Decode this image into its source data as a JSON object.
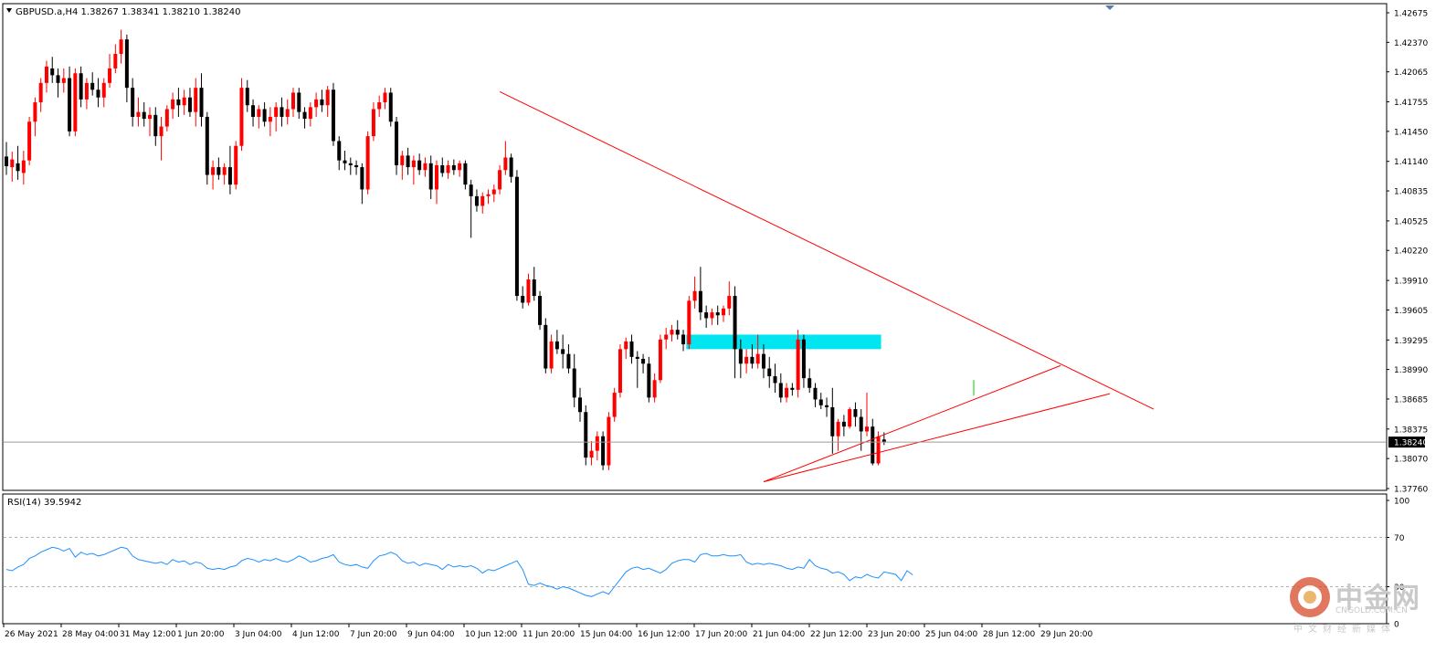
{
  "chart_data": [
    {
      "type": "candlestick",
      "symbol_header": "GBPUSD.a,H4  1.38267 1.38341 1.38210 1.38240",
      "ylim": [
        1.3776,
        1.42675
      ],
      "y_ticks": [
        "1.42675",
        "1.42370",
        "1.42065",
        "1.41755",
        "1.41450",
        "1.41140",
        "1.40835",
        "1.40525",
        "1.40220",
        "1.39910",
        "1.39605",
        "1.39295",
        "1.38990",
        "1.38685",
        "1.38375",
        "1.38070",
        "1.37760"
      ],
      "current_price": "1.38240",
      "x_tick_labels": [
        "26 May 2021",
        "28 May 04:00",
        "31 May 12:00",
        "1 Jun 20:00",
        "3 Jun 04:00",
        "4 Jun 12:00",
        "7 Jun 20:00",
        "9 Jun 04:00",
        "10 Jun 12:00",
        "11 Jun 20:00",
        "15 Jun 04:00",
        "16 Jun 12:00",
        "17 Jun 20:00",
        "21 Jun 04:00",
        "22 Jun 12:00",
        "23 Jun 20:00",
        "25 Jun 04:00",
        "28 Jun 12:00",
        "29 Jun 20:00"
      ],
      "colors": {
        "bull": "#ff0000",
        "bear": "#000000",
        "trendline": "#ff0000",
        "zone": "#00e5f0",
        "signal": "#00cc00"
      },
      "zone": {
        "from_bar": 1,
        "to_bar": 34,
        "bars_before_last": true,
        "price_low": 1.392,
        "price_high": 1.3935
      },
      "trendlines": [
        {
          "p1": [
            1.4186,
            "10 Jun 12:00"
          ],
          "p2": [
            1.3858,
            "beyond last bar"
          ]
        },
        {
          "p1": [
            1.3783,
            "18 Jun"
          ],
          "p2": [
            1.3903,
            "25 Jun"
          ]
        },
        {
          "p1": [
            1.3783,
            "18 Jun"
          ],
          "p2": [
            1.3874,
            "29 Jun"
          ]
        }
      ],
      "candles": [
        [
          1.4119,
          1.4134,
          1.41,
          1.4109
        ],
        [
          1.4108,
          1.4124,
          1.4093,
          1.4116
        ],
        [
          1.4112,
          1.413,
          1.4095,
          1.4104
        ],
        [
          1.4102,
          1.4125,
          1.409,
          1.4115
        ],
        [
          1.4115,
          1.416,
          1.411,
          1.4155
        ],
        [
          1.4155,
          1.418,
          1.414,
          1.4175
        ],
        [
          1.4175,
          1.42,
          1.4165,
          1.4195
        ],
        [
          1.4195,
          1.4218,
          1.4185,
          1.4212
        ],
        [
          1.421,
          1.4222,
          1.4195,
          1.4203
        ],
        [
          1.4203,
          1.421,
          1.418,
          1.4195
        ],
        [
          1.4195,
          1.421,
          1.4185,
          1.42
        ],
        [
          1.42,
          1.4212,
          1.414,
          1.4145
        ],
        [
          1.4145,
          1.421,
          1.414,
          1.4205
        ],
        [
          1.4205,
          1.4212,
          1.417,
          1.4178
        ],
        [
          1.4178,
          1.42,
          1.4168,
          1.4195
        ],
        [
          1.4195,
          1.4206,
          1.4182,
          1.4188
        ],
        [
          1.4188,
          1.42,
          1.417,
          1.418
        ],
        [
          1.418,
          1.42,
          1.417,
          1.4195
        ],
        [
          1.4195,
          1.4225,
          1.419,
          1.421
        ],
        [
          1.421,
          1.4235,
          1.4205,
          1.4225
        ],
        [
          1.4225,
          1.425,
          1.4215,
          1.424
        ],
        [
          1.424,
          1.4245,
          1.4175,
          1.419
        ],
        [
          1.419,
          1.42,
          1.415,
          1.416
        ],
        [
          1.416,
          1.418,
          1.415,
          1.4165
        ],
        [
          1.4165,
          1.4175,
          1.415,
          1.4158
        ],
        [
          1.4158,
          1.417,
          1.414,
          1.4162
        ],
        [
          1.4162,
          1.417,
          1.413,
          1.414
        ],
        [
          1.414,
          1.416,
          1.4115,
          1.415
        ],
        [
          1.415,
          1.4172,
          1.4145,
          1.4168
        ],
        [
          1.4168,
          1.4185,
          1.4158,
          1.4178
        ],
        [
          1.4178,
          1.419,
          1.416,
          1.4172
        ],
        [
          1.4172,
          1.4188,
          1.4162,
          1.418
        ],
        [
          1.418,
          1.419,
          1.416,
          1.4165
        ],
        [
          1.4165,
          1.42,
          1.415,
          1.419
        ],
        [
          1.419,
          1.4205,
          1.415,
          1.416
        ],
        [
          1.416,
          1.4165,
          1.409,
          1.41
        ],
        [
          1.41,
          1.4115,
          1.4085,
          1.4108
        ],
        [
          1.4108,
          1.4118,
          1.4095,
          1.41
        ],
        [
          1.41,
          1.4112,
          1.409,
          1.4108
        ],
        [
          1.4108,
          1.413,
          1.408,
          1.409
        ],
        [
          1.409,
          1.4135,
          1.4085,
          1.413
        ],
        [
          1.413,
          1.42,
          1.4125,
          1.419
        ],
        [
          1.419,
          1.4198,
          1.4165,
          1.4172
        ],
        [
          1.4172,
          1.4178,
          1.415,
          1.416
        ],
        [
          1.416,
          1.4172,
          1.4148,
          1.4168
        ],
        [
          1.4168,
          1.4175,
          1.415,
          1.4155
        ],
        [
          1.4155,
          1.417,
          1.414,
          1.416
        ],
        [
          1.416,
          1.4175,
          1.4145,
          1.417
        ],
        [
          1.417,
          1.418,
          1.415,
          1.416
        ],
        [
          1.416,
          1.4178,
          1.4152,
          1.4168
        ],
        [
          1.4168,
          1.419,
          1.416,
          1.4185
        ],
        [
          1.4185,
          1.419,
          1.4158,
          1.4165
        ],
        [
          1.4165,
          1.417,
          1.4148,
          1.4158
        ],
        [
          1.4158,
          1.4175,
          1.415,
          1.417
        ],
        [
          1.417,
          1.4185,
          1.416,
          1.4178
        ],
        [
          1.4178,
          1.4188,
          1.4165,
          1.4172
        ],
        [
          1.4172,
          1.4192,
          1.416,
          1.4188
        ],
        [
          1.4188,
          1.4195,
          1.413,
          1.4135
        ],
        [
          1.4135,
          1.414,
          1.4105,
          1.4115
        ],
        [
          1.4115,
          1.4125,
          1.4105,
          1.4112
        ],
        [
          1.4112,
          1.4118,
          1.41,
          1.411
        ],
        [
          1.411,
          1.4115,
          1.41,
          1.4108
        ],
        [
          1.4108,
          1.4112,
          1.407,
          1.4085
        ],
        [
          1.4085,
          1.4145,
          1.408,
          1.414
        ],
        [
          1.414,
          1.4175,
          1.4135,
          1.4168
        ],
        [
          1.4168,
          1.4182,
          1.416,
          1.4175
        ],
        [
          1.4175,
          1.419,
          1.4168,
          1.4185
        ],
        [
          1.4185,
          1.419,
          1.415,
          1.4155
        ],
        [
          1.4155,
          1.416,
          1.41,
          1.411
        ],
        [
          1.411,
          1.4125,
          1.4095,
          1.412
        ],
        [
          1.412,
          1.4128,
          1.41,
          1.4108
        ],
        [
          1.4108,
          1.412,
          1.409,
          1.4115
        ],
        [
          1.4115,
          1.4122,
          1.41,
          1.4105
        ],
        [
          1.4105,
          1.4118,
          1.4098,
          1.4112
        ],
        [
          1.4112,
          1.412,
          1.4075,
          1.4085
        ],
        [
          1.4085,
          1.4115,
          1.407,
          1.411
        ],
        [
          1.411,
          1.4118,
          1.4098,
          1.4102
        ],
        [
          1.4102,
          1.4115,
          1.4096,
          1.411
        ],
        [
          1.411,
          1.4116,
          1.41,
          1.4105
        ],
        [
          1.4105,
          1.4115,
          1.4098,
          1.4112
        ],
        [
          1.4112,
          1.4115,
          1.4085,
          1.409
        ],
        [
          1.409,
          1.4095,
          1.4035,
          1.4078
        ],
        [
          1.4078,
          1.4085,
          1.4062,
          1.4068
        ],
        [
          1.4068,
          1.4082,
          1.406,
          1.4078
        ],
        [
          1.4078,
          1.4085,
          1.407,
          1.408
        ],
        [
          1.408,
          1.409,
          1.4072,
          1.4085
        ],
        [
          1.4085,
          1.411,
          1.408,
          1.4105
        ],
        [
          1.4105,
          1.4135,
          1.41,
          1.4118
        ],
        [
          1.4118,
          1.4122,
          1.4092,
          1.4098
        ],
        [
          1.4098,
          1.4105,
          1.397,
          1.3975
        ],
        [
          1.3975,
          1.3985,
          1.3962,
          1.3968
        ],
        [
          1.3968,
          1.3998,
          1.3965,
          1.3992
        ],
        [
          1.3992,
          1.4005,
          1.397,
          1.3975
        ],
        [
          1.3975,
          1.398,
          1.394,
          1.3945
        ],
        [
          1.3945,
          1.3952,
          1.3895,
          1.39
        ],
        [
          1.39,
          1.3935,
          1.3895,
          1.3928
        ],
        [
          1.3928,
          1.394,
          1.3915,
          1.392
        ],
        [
          1.392,
          1.3935,
          1.39,
          1.3915
        ],
        [
          1.3915,
          1.3925,
          1.3895,
          1.39
        ],
        [
          1.39,
          1.3915,
          1.386,
          1.387
        ],
        [
          1.387,
          1.388,
          1.3845,
          1.3855
        ],
        [
          1.3855,
          1.3862,
          1.38,
          1.3808
        ],
        [
          1.3808,
          1.3825,
          1.38,
          1.3815
        ],
        [
          1.3815,
          1.3835,
          1.3805,
          1.383
        ],
        [
          1.383,
          1.3835,
          1.3795,
          1.38
        ],
        [
          1.38,
          1.3855,
          1.3795,
          1.385
        ],
        [
          1.385,
          1.388,
          1.3845,
          1.3875
        ],
        [
          1.3875,
          1.3925,
          1.387,
          1.392
        ],
        [
          1.392,
          1.3932,
          1.391,
          1.3928
        ],
        [
          1.3928,
          1.3935,
          1.3905,
          1.3912
        ],
        [
          1.3912,
          1.3918,
          1.388,
          1.391
        ],
        [
          1.391,
          1.3915,
          1.3895,
          1.3905
        ],
        [
          1.3905,
          1.3912,
          1.3865,
          1.387
        ],
        [
          1.387,
          1.3895,
          1.3865,
          1.3888
        ],
        [
          1.3888,
          1.3935,
          1.3885,
          1.393
        ],
        [
          1.393,
          1.3942,
          1.392,
          1.3935
        ],
        [
          1.3935,
          1.3945,
          1.3928,
          1.394
        ],
        [
          1.394,
          1.395,
          1.393,
          1.3935
        ],
        [
          1.3935,
          1.394,
          1.3918,
          1.3925
        ],
        [
          1.3925,
          1.3975,
          1.392,
          1.397
        ],
        [
          1.397,
          1.3995,
          1.3962,
          1.398
        ],
        [
          1.398,
          1.4005,
          1.395,
          1.3958
        ],
        [
          1.3958,
          1.3965,
          1.3942,
          1.3952
        ],
        [
          1.3952,
          1.3962,
          1.3945,
          1.3958
        ],
        [
          1.3958,
          1.3965,
          1.3945,
          1.3955
        ],
        [
          1.3955,
          1.3965,
          1.3948,
          1.3962
        ],
        [
          1.3962,
          1.399,
          1.3955,
          1.3975
        ],
        [
          1.3975,
          1.3985,
          1.389,
          1.392
        ],
        [
          1.392,
          1.393,
          1.389,
          1.3905
        ],
        [
          1.3905,
          1.392,
          1.3895,
          1.3912
        ],
        [
          1.3912,
          1.3925,
          1.39,
          1.3905
        ],
        [
          1.3905,
          1.3935,
          1.39,
          1.3915
        ],
        [
          1.3915,
          1.3925,
          1.389,
          1.39
        ],
        [
          1.39,
          1.3912,
          1.388,
          1.3892
        ],
        [
          1.3892,
          1.3905,
          1.3875,
          1.3885
        ],
        [
          1.3885,
          1.3895,
          1.3865,
          1.387
        ],
        [
          1.387,
          1.3885,
          1.3865,
          1.388
        ],
        [
          1.388,
          1.3885,
          1.3872,
          1.3878
        ],
        [
          1.3878,
          1.394,
          1.387,
          1.393
        ],
        [
          1.393,
          1.3935,
          1.388,
          1.389
        ],
        [
          1.389,
          1.39,
          1.3875,
          1.388
        ],
        [
          1.388,
          1.3885,
          1.386,
          1.3868
        ],
        [
          1.3868,
          1.3875,
          1.3858,
          1.3862
        ],
        [
          1.3862,
          1.387,
          1.385,
          1.386
        ],
        [
          1.386,
          1.388,
          1.3812,
          1.383
        ],
        [
          1.383,
          1.3848,
          1.3815,
          1.3845
        ],
        [
          1.3845,
          1.3852,
          1.383,
          1.384
        ],
        [
          1.384,
          1.386,
          1.3838,
          1.3858
        ],
        [
          1.3858,
          1.3865,
          1.384,
          1.385
        ],
        [
          1.385,
          1.3858,
          1.3815,
          1.3835
        ],
        [
          1.3835,
          1.3875,
          1.383,
          1.384
        ],
        [
          1.384,
          1.3848,
          1.38,
          1.3802
        ],
        [
          1.3802,
          1.3835,
          1.38,
          1.383
        ],
        [
          1.38267,
          1.38341,
          1.3821,
          1.3824
        ]
      ]
    },
    {
      "type": "line",
      "header": "RSI(14) 39.5942",
      "ylim": [
        0,
        100
      ],
      "y_ticks": [
        "100",
        "70",
        "30",
        "0"
      ],
      "levels": [
        70,
        30
      ],
      "series": [
        {
          "values": [
            44,
            43,
            46,
            48,
            53,
            55,
            58,
            60,
            62,
            61,
            59,
            61,
            54,
            58,
            56,
            57,
            55,
            56,
            58,
            60,
            62,
            61,
            55,
            52,
            51,
            50,
            49,
            50,
            48,
            52,
            50,
            51,
            48,
            50,
            49,
            45,
            44,
            45,
            44,
            46,
            47,
            51,
            53,
            52,
            50,
            52,
            51,
            53,
            51,
            50,
            52,
            55,
            53,
            50,
            51,
            53,
            54,
            56,
            50,
            48,
            47,
            48,
            46,
            45,
            51,
            55,
            56,
            58,
            56,
            51,
            49,
            50,
            47,
            49,
            48,
            47,
            44,
            48,
            46,
            47,
            46,
            47,
            45,
            41,
            44,
            43,
            45,
            47,
            49,
            51,
            44,
            32,
            31,
            33,
            31,
            30,
            28,
            30,
            29,
            27,
            25,
            23,
            22,
            24,
            26,
            24,
            30,
            36,
            42,
            45,
            46,
            44,
            45,
            43,
            41,
            44,
            49,
            51,
            52,
            52,
            50,
            56,
            57,
            55,
            55,
            56,
            55,
            55,
            56,
            50,
            48,
            49,
            48,
            49,
            48,
            47,
            45,
            44,
            46,
            45,
            52,
            47,
            45,
            44,
            41,
            42,
            40,
            35,
            38,
            37,
            40,
            38,
            37,
            42,
            41,
            40,
            35,
            43,
            39.6
          ]
        }
      ]
    }
  ],
  "watermark": {
    "name": "中金网",
    "domain": "CNGOLD.COM.CN",
    "slogan": "中文财经新媒体"
  }
}
